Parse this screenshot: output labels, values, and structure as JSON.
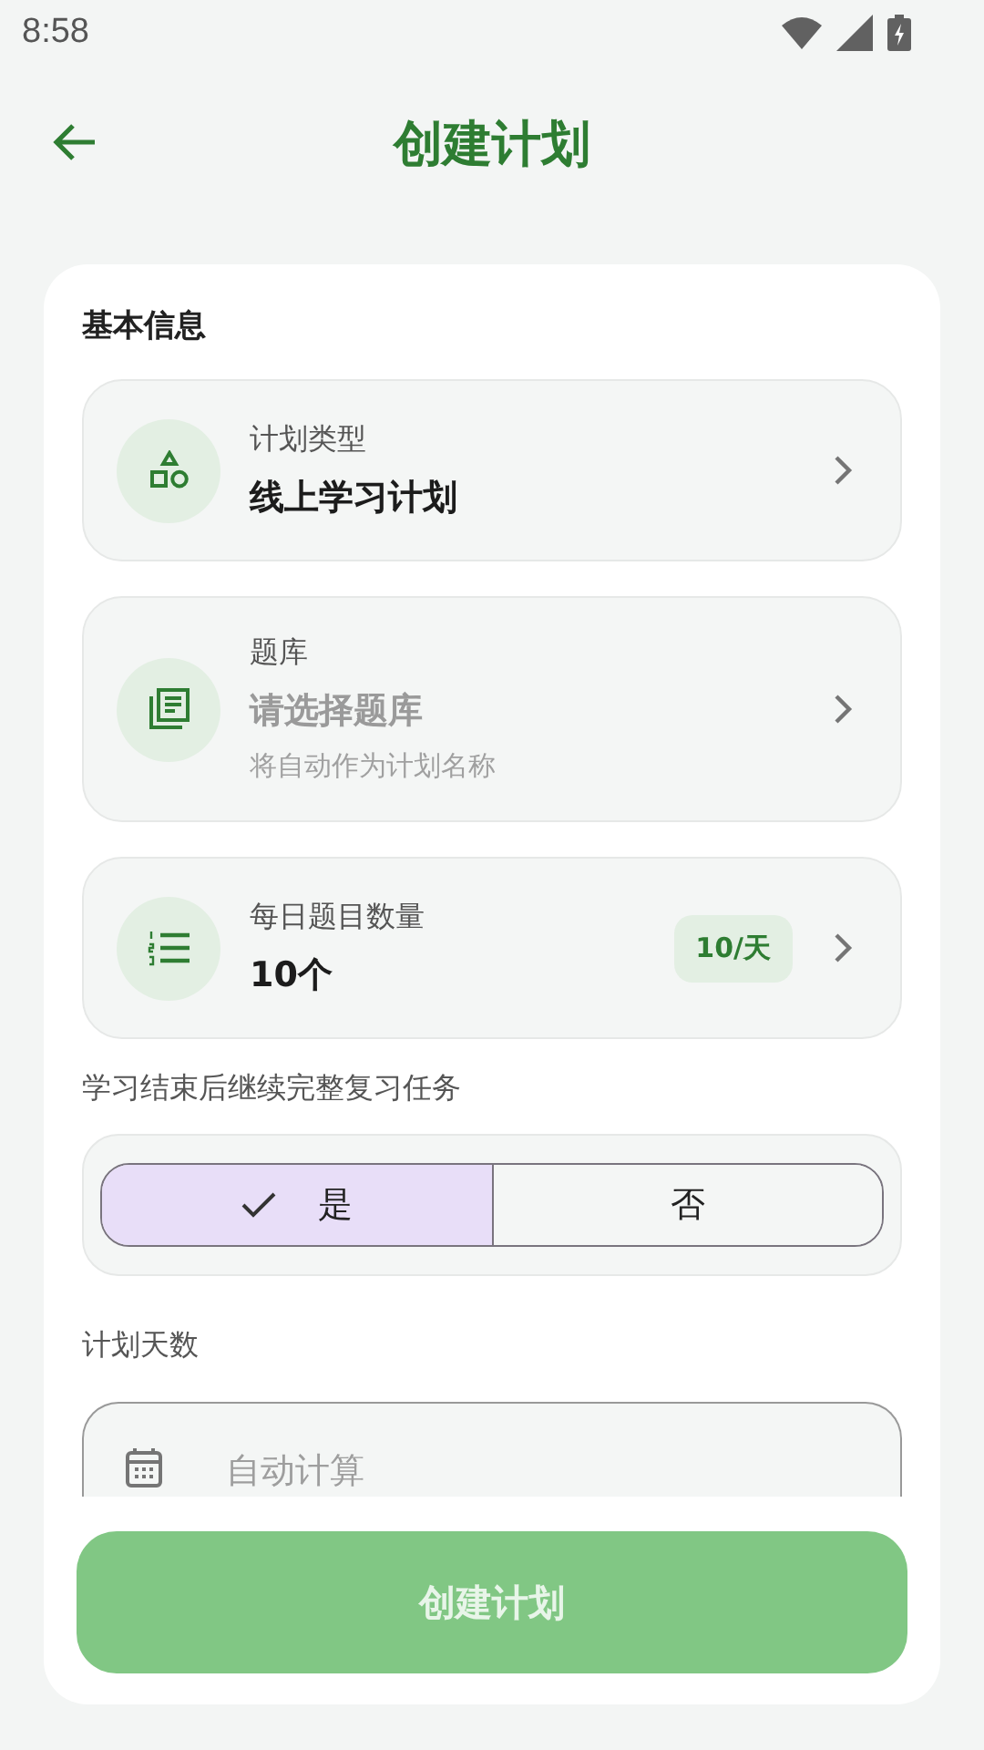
{
  "status_bar": {
    "time": "8:58"
  },
  "header": {
    "title": "创建计划"
  },
  "section": {
    "title": "基本信息"
  },
  "items": [
    {
      "kind": "type",
      "label": "计划类型",
      "value": "线上学习计划"
    },
    {
      "kind": "bank",
      "label": "题库",
      "placeholder": "请选择题库",
      "hint": "将自动作为计划名称"
    },
    {
      "kind": "count",
      "label": "每日题目数量",
      "value": "10个",
      "badge": "10/天"
    }
  ],
  "review": {
    "label": "学习结束后继续完整复习任务",
    "options": [
      {
        "label": "是",
        "selected": true
      },
      {
        "label": "否",
        "selected": false
      }
    ]
  },
  "days": {
    "label": "计划天数",
    "placeholder": "自动计算"
  },
  "submit": {
    "label": "创建计划",
    "disabled": true
  }
}
